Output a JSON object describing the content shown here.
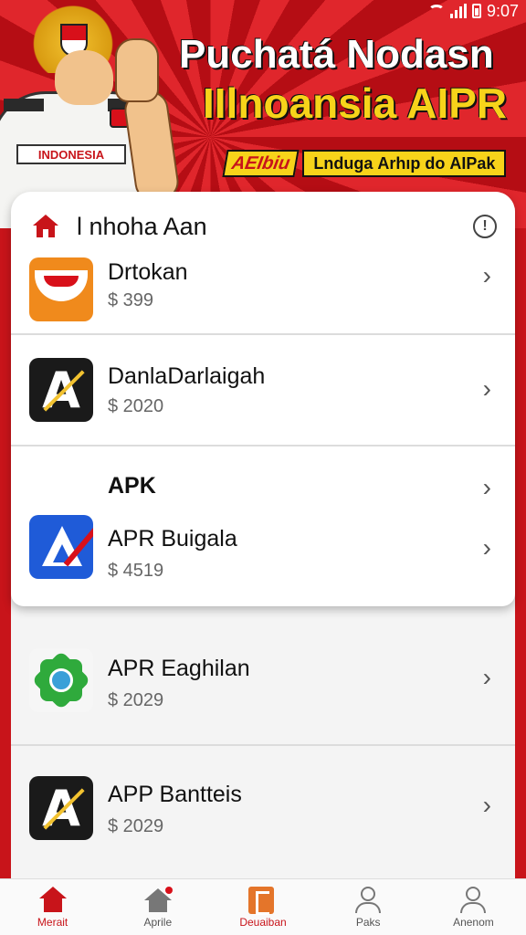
{
  "status_bar": {
    "time": "9:07"
  },
  "hero": {
    "title_line1": "Puchatá Nodasn",
    "title_line2": "IIlnoansia AIPR",
    "tag_chip": "AEIbiu",
    "tag_text": "Lndugа Arhıp dо AIPak",
    "name_tag": "INDONESIA"
  },
  "card": {
    "title": "l nhoha Aan"
  },
  "apps": [
    {
      "name": "Drtokan",
      "price": "$ 399",
      "icon": "orange-bowl-icon"
    },
    {
      "name": "DanlaDarlaigah",
      "price": "$ 2020",
      "icon": "dark-a-icon"
    },
    {
      "name": "APK",
      "price": "",
      "icon": ""
    },
    {
      "name": "APR Buigala",
      "price": "$ 4519",
      "icon": "blue-a-icon"
    },
    {
      "name": "APR Eaghilan",
      "price": "$ 2029",
      "icon": "green-badge-icon"
    },
    {
      "name": "APP Banttеis",
      "price": "$ 2029",
      "icon": "dark-a-icon"
    }
  ],
  "nav": [
    {
      "label": "Merait",
      "active": true
    },
    {
      "label": "Aprile",
      "active": false
    },
    {
      "label": "Deuaiban",
      "active": false
    },
    {
      "label": "Paks",
      "active": false
    },
    {
      "label": "Anenom",
      "active": false
    }
  ],
  "colors": {
    "brand_red": "#c8141a",
    "accent_yellow": "#f7d31a"
  }
}
